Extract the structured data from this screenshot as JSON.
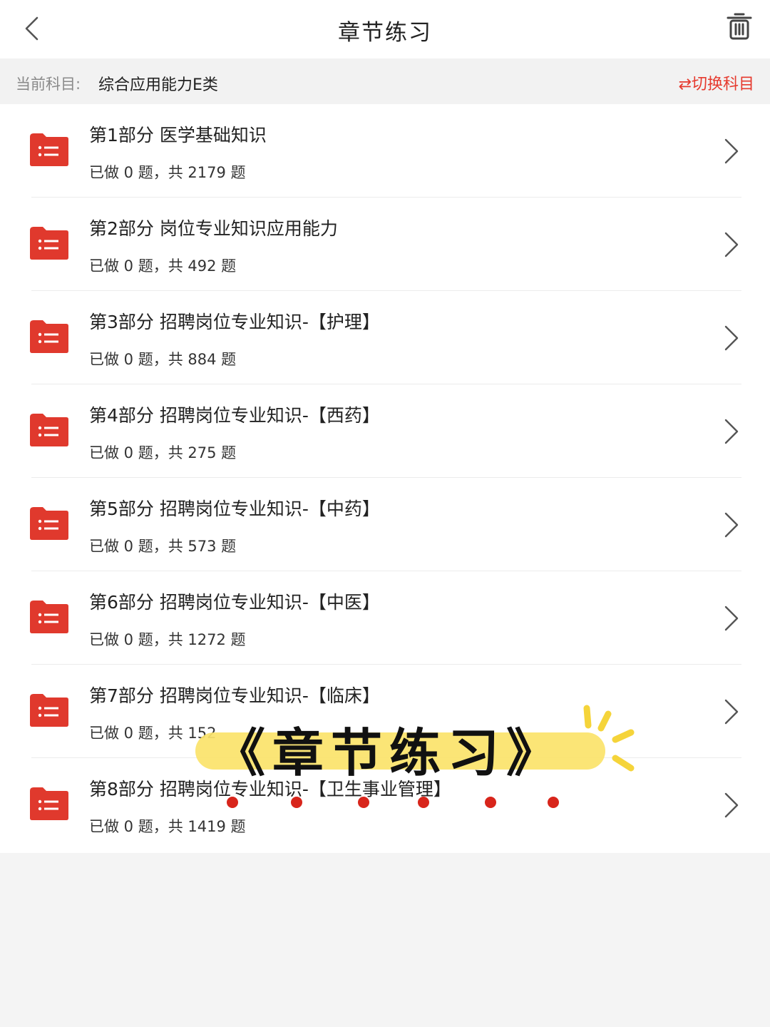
{
  "header": {
    "title": "章节练习",
    "back_icon": "chevron-left-icon",
    "trash_icon": "trash-icon"
  },
  "subject_bar": {
    "label": "当前科目:",
    "value": "综合应用能力E类",
    "switch_label": "⇄切换科目"
  },
  "chapters": [
    {
      "title": "第1部分 医学基础知识",
      "stats": "已做 0 题，共 2179 题"
    },
    {
      "title": "第2部分 岗位专业知识应用能力",
      "stats": "已做 0 题，共 492 题"
    },
    {
      "title": "第3部分 招聘岗位专业知识-【护理】",
      "stats": "已做 0 题，共 884 题"
    },
    {
      "title": "第4部分 招聘岗位专业知识-【西药】",
      "stats": "已做 0 题，共 275 题"
    },
    {
      "title": "第5部分 招聘岗位专业知识-【中药】",
      "stats": "已做 0 题，共 573 题"
    },
    {
      "title": "第6部分 招聘岗位专业知识-【中医】",
      "stats": "已做 0 题，共 1272 题"
    },
    {
      "title": "第7部分 招聘岗位专业知识-【临床】",
      "stats": "已做 0 题，共 152"
    },
    {
      "title": "第8部分 招聘岗位专业知识-【卫生事业管理】",
      "stats": "已做 0 题，共 1419 题"
    }
  ],
  "overlay": {
    "text": "《章节练习》"
  },
  "colors": {
    "accent": "#e63a2e",
    "folder": "#e0392d",
    "highlight": "#fbe36a",
    "dots": "#d8251b"
  }
}
